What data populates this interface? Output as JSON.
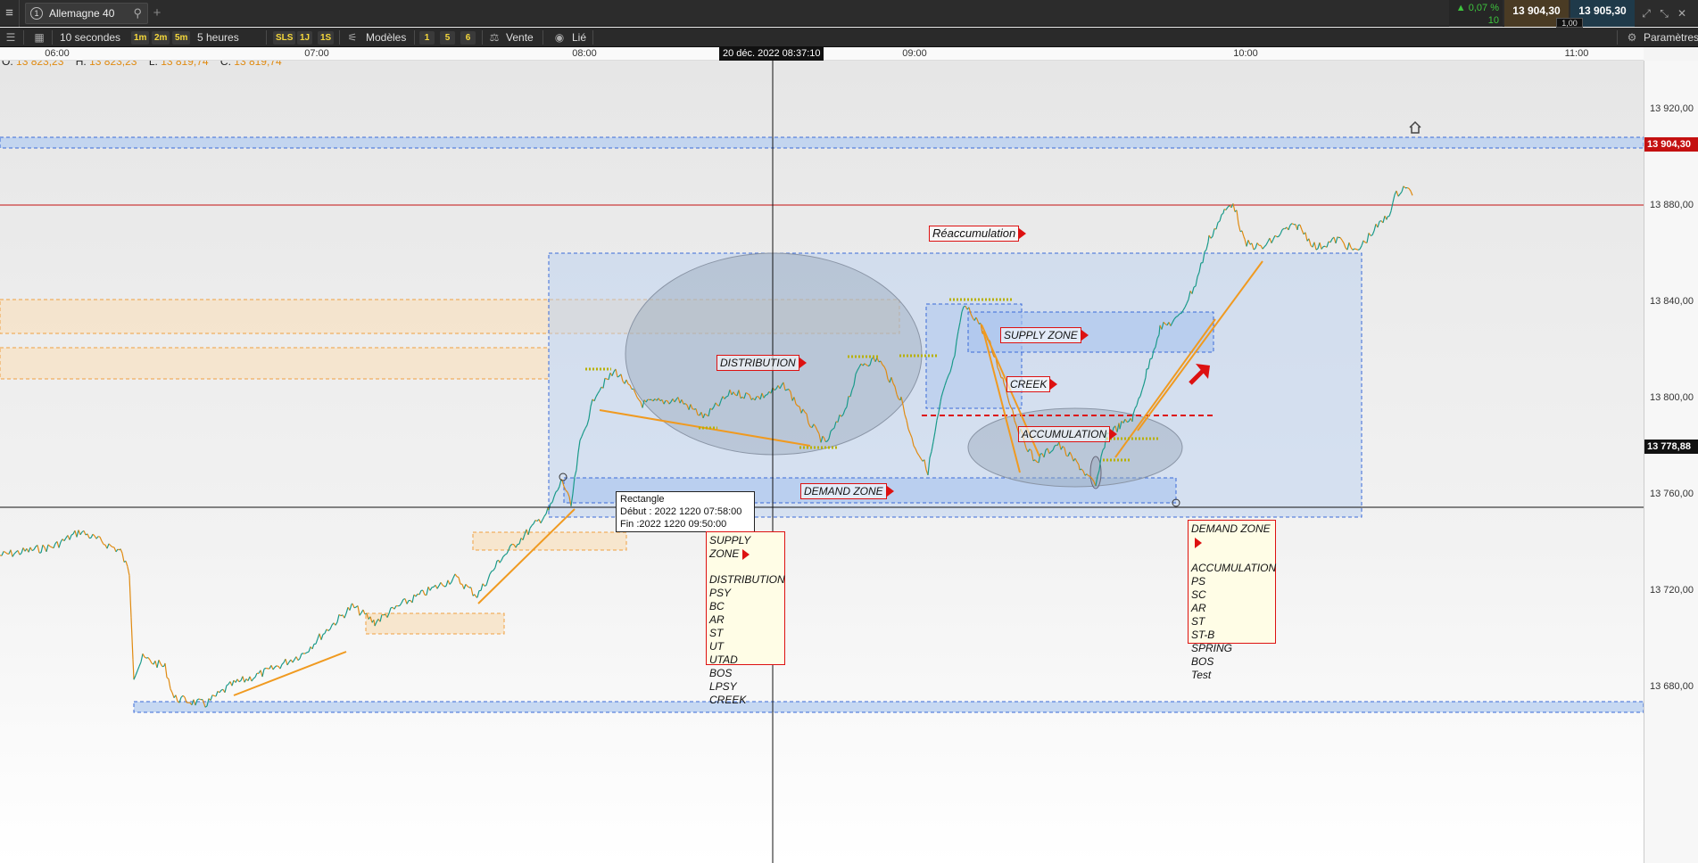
{
  "topbar": {
    "instrument_number": "1",
    "instrument_name": "Allemagne 40",
    "change_pct": "▲ 0,07 %",
    "change_qty": "10",
    "bid": "13 904,30",
    "ask": "13 905,30",
    "spread": "1,00"
  },
  "toolbar": {
    "interval": "10 secondes",
    "periods": [
      "1m",
      "2m",
      "5m"
    ],
    "range": "5 heures",
    "styles": [
      "SLS",
      "1J",
      "1S"
    ],
    "models": "Modèles",
    "qty_buttons": [
      "1",
      "5",
      "6"
    ],
    "sell": "Vente",
    "linked": "Lié",
    "settings": "Paramètres"
  },
  "time_axis": {
    "labels": [
      "06:00",
      "07:00",
      "08:00",
      "09:00",
      "10:00",
      "11:00"
    ],
    "cursor_time": "20 déc. 2022 08:37:10"
  },
  "price_axis": {
    "labels": [
      "13 920,00",
      "13 880,00",
      "13 840,00",
      "13 800,00",
      "13 760,00",
      "13 720,00",
      "13 680,00"
    ],
    "last_price": "13 904,30",
    "cursor_price": "13 778,88"
  },
  "ohlc": {
    "o_label": "O:",
    "o": "13 823,23",
    "h_label": "H:",
    "h": "13 823,23",
    "l_label": "L:",
    "l": "13 819,74",
    "c_label": "C:",
    "c": "13 819,74"
  },
  "annotations": {
    "reaccumulation": "Réaccumulation",
    "distribution": "DISTRIBUTION",
    "supply_zone": "SUPPLY ZONE",
    "creek": "CREEK",
    "accumulation": "ACCUMULATION",
    "demand_zone": "DEMAND ZONE"
  },
  "tooltip": {
    "title": "Rectangle",
    "start": "Début : 2022 1220 07:58:00",
    "end": "Fin :2022 1220 09:50:00"
  },
  "note_supply": {
    "header": "SUPPLY ZONE",
    "items": [
      "DISTRIBUTION",
      "PSY",
      "BC",
      "AR",
      "ST",
      "UT",
      "UTAD",
      "BOS",
      "LPSY",
      "CREEK"
    ]
  },
  "note_demand": {
    "header": "DEMAND ZONE",
    "items": [
      "ACCUMULATION",
      "PS",
      "SC",
      "AR",
      "ST",
      "ST-B",
      "SPRING",
      "BOS",
      "Test"
    ]
  },
  "colors": {
    "up": "#1a9a8a",
    "down": "#e08a10",
    "zone_blue": "#b9cff0",
    "zone_orange": "#f7e2c4",
    "last_price": "#c41010"
  }
}
